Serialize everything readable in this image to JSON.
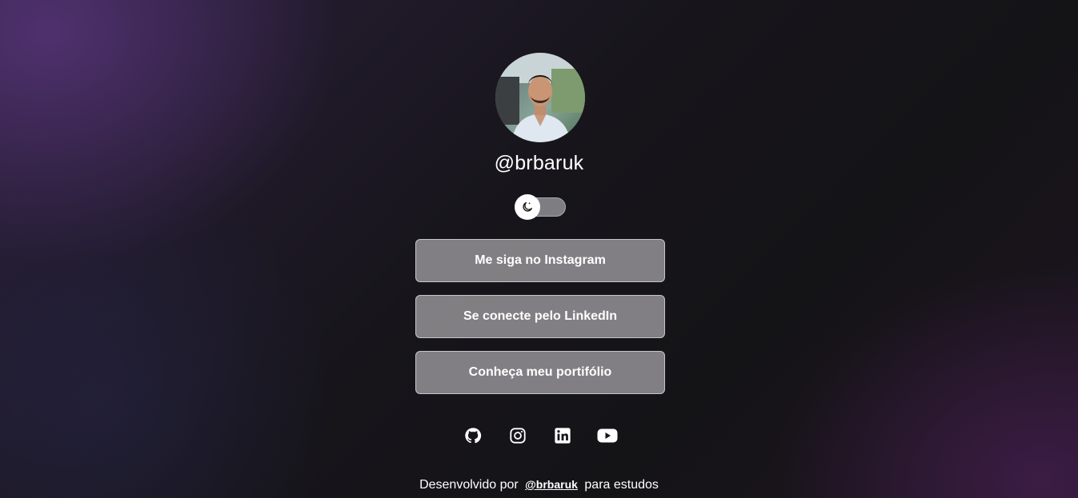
{
  "profile": {
    "handle": "@brbaruk",
    "avatar_icon": "profile-photo"
  },
  "theme_toggle": {
    "icon": "moon-icon",
    "state": "dark"
  },
  "links": [
    {
      "label": "Me siga no Instagram"
    },
    {
      "label": "Se conecte pelo LinkedIn"
    },
    {
      "label": "Conheça meu portifólio"
    }
  ],
  "socials": [
    {
      "icon": "github-icon"
    },
    {
      "icon": "instagram-icon"
    },
    {
      "icon": "linkedin-icon"
    },
    {
      "icon": "youtube-icon"
    }
  ],
  "footer": {
    "prefix": "Desenvolvido por",
    "link": "@brbaruk",
    "suffix": "para estudos"
  },
  "colors": {
    "button_bg": "#9e9ca2",
    "text": "#ffffff",
    "background": "#16141a",
    "accent_purple": "#563478"
  }
}
